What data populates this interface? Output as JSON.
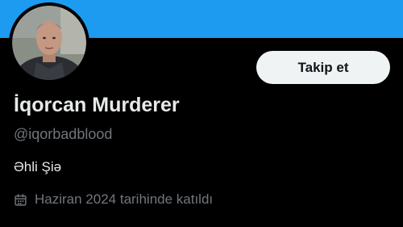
{
  "profile": {
    "display_name": "İqorcan Murderer",
    "handle": "@iqorbadblood",
    "bio": "Əhli Şiə",
    "joined": "Haziran 2024 tarihinde katıldı"
  },
  "actions": {
    "follow_label": "Takip et"
  },
  "icons": {
    "avatar": "profile-photo",
    "joined": "calendar-icon"
  },
  "colors": {
    "banner": "#1d9bf0",
    "background": "#000000",
    "primary_text": "#e7e9ea",
    "secondary_text": "#71767b",
    "follow_button_bg": "#eff3f4",
    "follow_button_text": "#0f1419"
  }
}
